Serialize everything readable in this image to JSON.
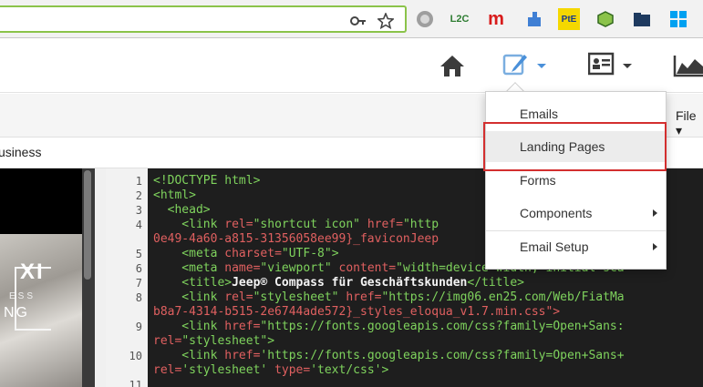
{
  "browser": {
    "extensions": [
      "L2C",
      "m",
      "PtE"
    ],
    "accent_green": "#8bc34a"
  },
  "toolbar": {
    "icons": [
      "home-icon",
      "pencil-edit-icon",
      "contact-card-icon",
      "chart-icon"
    ],
    "accent_blue": "#4a90d9"
  },
  "subheader": {
    "file_link": "File ▾"
  },
  "breadcrumb": {
    "text": "usiness"
  },
  "preview": {
    "text1": "XI",
    "text2": "ESS",
    "text3": "NG"
  },
  "editor": {
    "line_numbers": [
      "1",
      "2",
      "3",
      "4",
      "",
      "5",
      "6",
      "7",
      "8",
      "",
      "9",
      "",
      "10",
      "",
      "11"
    ]
  },
  "menu": {
    "items": [
      {
        "label": "Emails",
        "submenu": false
      },
      {
        "label": "Landing Pages",
        "submenu": false,
        "selected": true
      },
      {
        "label": "Forms",
        "submenu": false
      },
      {
        "label": "Components",
        "submenu": true
      },
      {
        "label": "Email Setup",
        "submenu": true
      }
    ],
    "highlight_color": "#d32f2f"
  }
}
